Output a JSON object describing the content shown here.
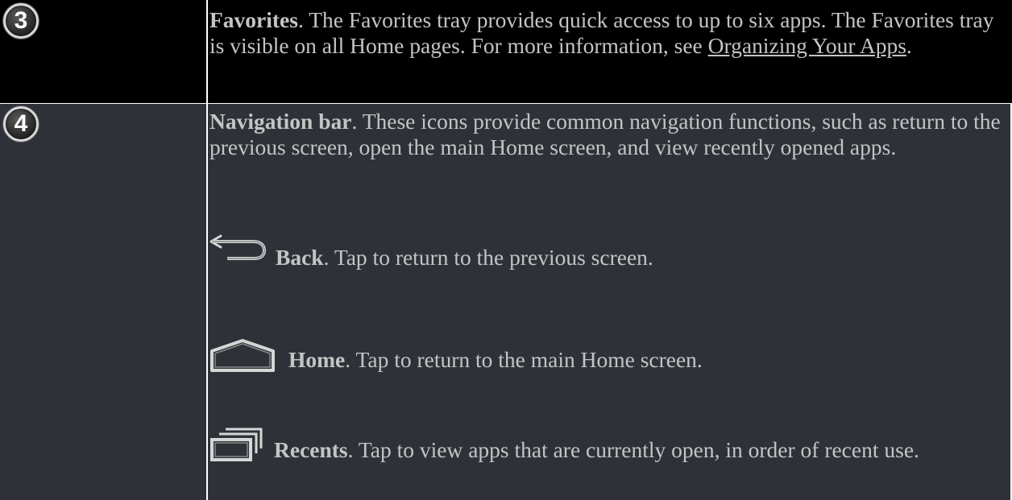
{
  "rows": {
    "favorites": {
      "number": "3",
      "title": "Favorites",
      "text_before_link": ". The Favorites tray provides quick access to up to six apps. The Favorites tray is visible on all Home pages. For more information, see ",
      "link_text": "Organizing Your Apps",
      "text_after_link": "."
    },
    "navigation": {
      "number": "4",
      "title": "Navigation bar",
      "text": ". These icons provide common navigation functions, such as return to the previous screen, open the main Home screen, and view recently opened apps.",
      "items": [
        {
          "icon": "back-arrow-icon",
          "label": "Back",
          "text": ". Tap to return to the previous screen."
        },
        {
          "icon": "home-outline-icon",
          "label": "Home",
          "text": ". Tap to return to the main Home screen."
        },
        {
          "icon": "recents-icon",
          "label": "Recents",
          "text": ". Tap to view apps that are currently open, in order of recent use."
        }
      ]
    }
  },
  "colors": {
    "row_favorites_bg": "#000000",
    "row_navigation_bg": "#2e3238",
    "text": "#c4c4c4",
    "grid_line": "#ffffff"
  }
}
